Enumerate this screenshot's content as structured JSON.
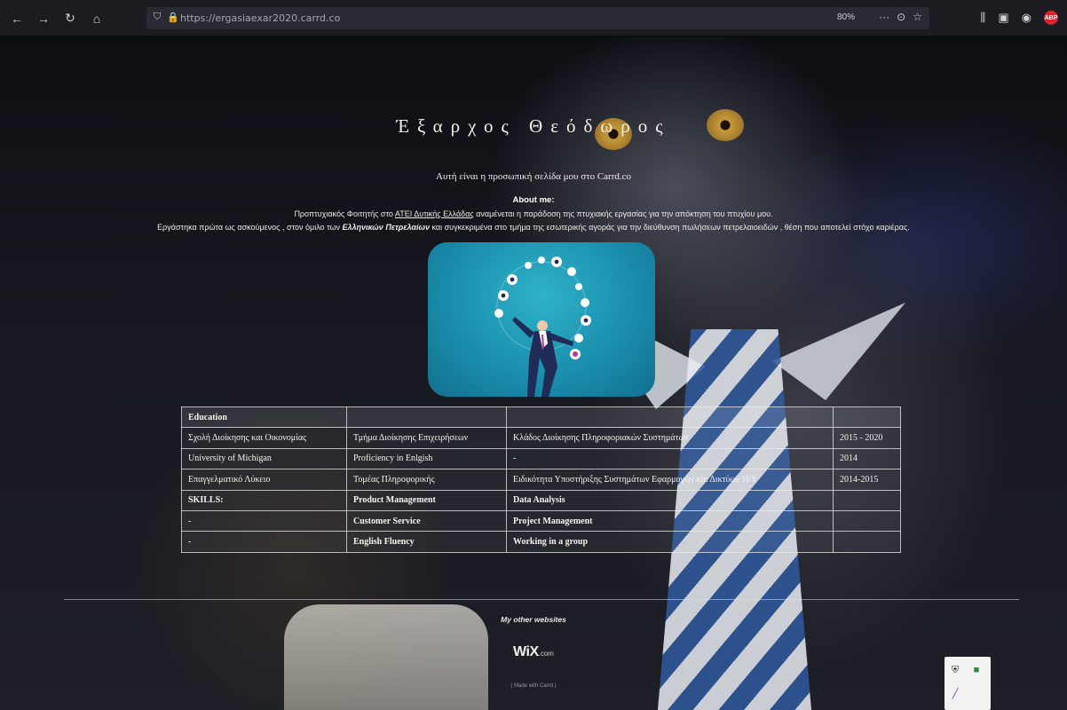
{
  "browser": {
    "url": "https://ergasiaexar2020.carrd.co",
    "zoom": "80%",
    "nav_icons": [
      "back-icon",
      "forward-icon",
      "reload-icon",
      "home-icon"
    ],
    "toolbar_icons": [
      "library-icon",
      "sidebar-icon",
      "account-icon"
    ],
    "abp_label": "ABP"
  },
  "page": {
    "title": "Έξαρχος Θεόδωρος",
    "subtitle": "Αυτή είναι η προσωπική σελίδα μου στο Carrd.co",
    "about_heading": "About me:",
    "about_line1": {
      "before": "Προπτυχιακός Φοιτητής στο ",
      "link": "ΑΤΕΙ Δυτικής Ελλάδας",
      "after": " αναμένεται η παράδοση της πτυχιακής εργασίας για την απόκτηση του πτυχίου μου."
    },
    "about_line2": {
      "before": "Εργάστηκα πρώτα ως ασκούμενος , στον όμιλο των ",
      "bold": "Ελληνικών Πετρελαίων",
      "after": " και συγκεκριμένα στο τμήμα της εσωτερικής αγοράς για την διεύθυνση πωλήσεων πετρελαιοειδών , θέση που αποτελεί στόχο καριέρας."
    },
    "table": {
      "header": [
        "Education",
        "",
        "",
        ""
      ],
      "rows": [
        [
          "Σχολή Διοίκησης και Οικονομίας",
          "Τμήμα Διοίκησης Επιχειρήσεων",
          "Κλάδος Διοίκησης Πληροφοριακών Συστημάτων",
          "2015 - 2020"
        ],
        [
          "University of Michigan",
          "Proficiency in Enlgish",
          "-",
          "2014"
        ],
        [
          "Επαγγελματικό Λύκειο",
          "Τομέας Πληροφορικής",
          "Ειδικότητα Υποστήριξης Συστημάτων Εφαρμογών και Δικτύων Η/Υ",
          "2014-2015"
        ],
        [
          "SKILLS:",
          "Product Management",
          "Data Analysis",
          ""
        ],
        [
          "-",
          "Customer Service",
          "Project Management",
          ""
        ],
        [
          "-",
          "English Fluency",
          "Working in a group",
          ""
        ]
      ]
    },
    "footer": {
      "other_websites": "My other websites",
      "wix_main": "WiX",
      "wix_suffix": ".com",
      "made_with": "( Made with Carrd )"
    }
  }
}
